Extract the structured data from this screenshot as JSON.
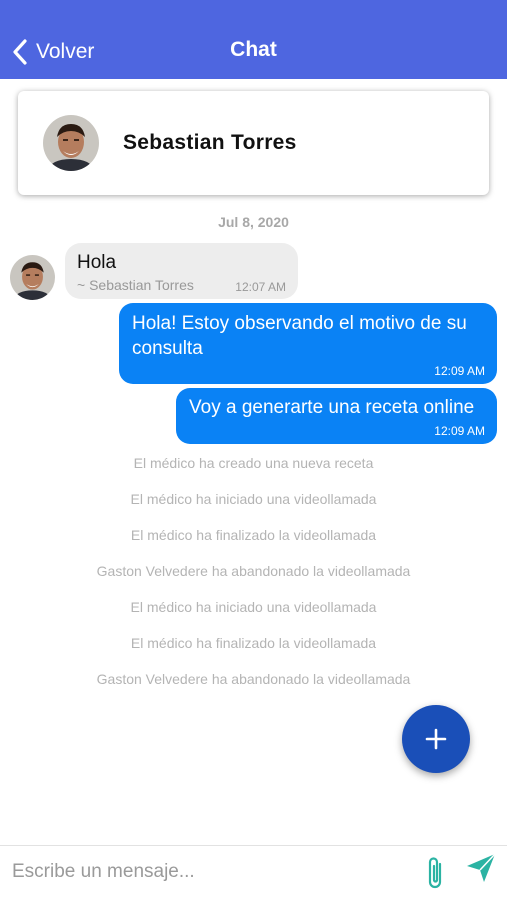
{
  "header": {
    "back_label": "Volver",
    "title": "Chat",
    "background_color": "#4e66e0"
  },
  "contact": {
    "name": "Sebastian Torres"
  },
  "conversation": {
    "date": "Jul 8, 2020",
    "incoming": {
      "text": "Hola",
      "author": "~ Sebastian Torres",
      "time": "12:07 AM"
    },
    "outgoing": [
      {
        "text": "Hola! Estoy observando el motivo de su consulta",
        "time": "12:09 AM"
      },
      {
        "text": "Voy a generarte una receta online",
        "time": "12:09 AM"
      }
    ],
    "system_messages": [
      "El médico ha creado una nueva receta",
      "El médico ha iniciado una videollamada",
      "El médico ha finalizado la videollamada",
      "Gaston Velvedere ha abandonado la videollamada",
      "El médico ha iniciado una videollamada",
      "El médico ha finalizado la videollamada",
      "Gaston Velvedere ha abandonado la videollamada"
    ]
  },
  "composer": {
    "placeholder": "Escribe un mensaje...",
    "value": ""
  },
  "icons": {
    "back": "chevron-left-icon",
    "fab": "plus-icon",
    "attach": "paperclip-icon",
    "send": "send-icon"
  },
  "colors": {
    "outgoing_bubble": "#0a82f5",
    "incoming_bubble": "#ededed",
    "fab": "#1a4fb8",
    "composer_icons": "#2bb3a3"
  }
}
